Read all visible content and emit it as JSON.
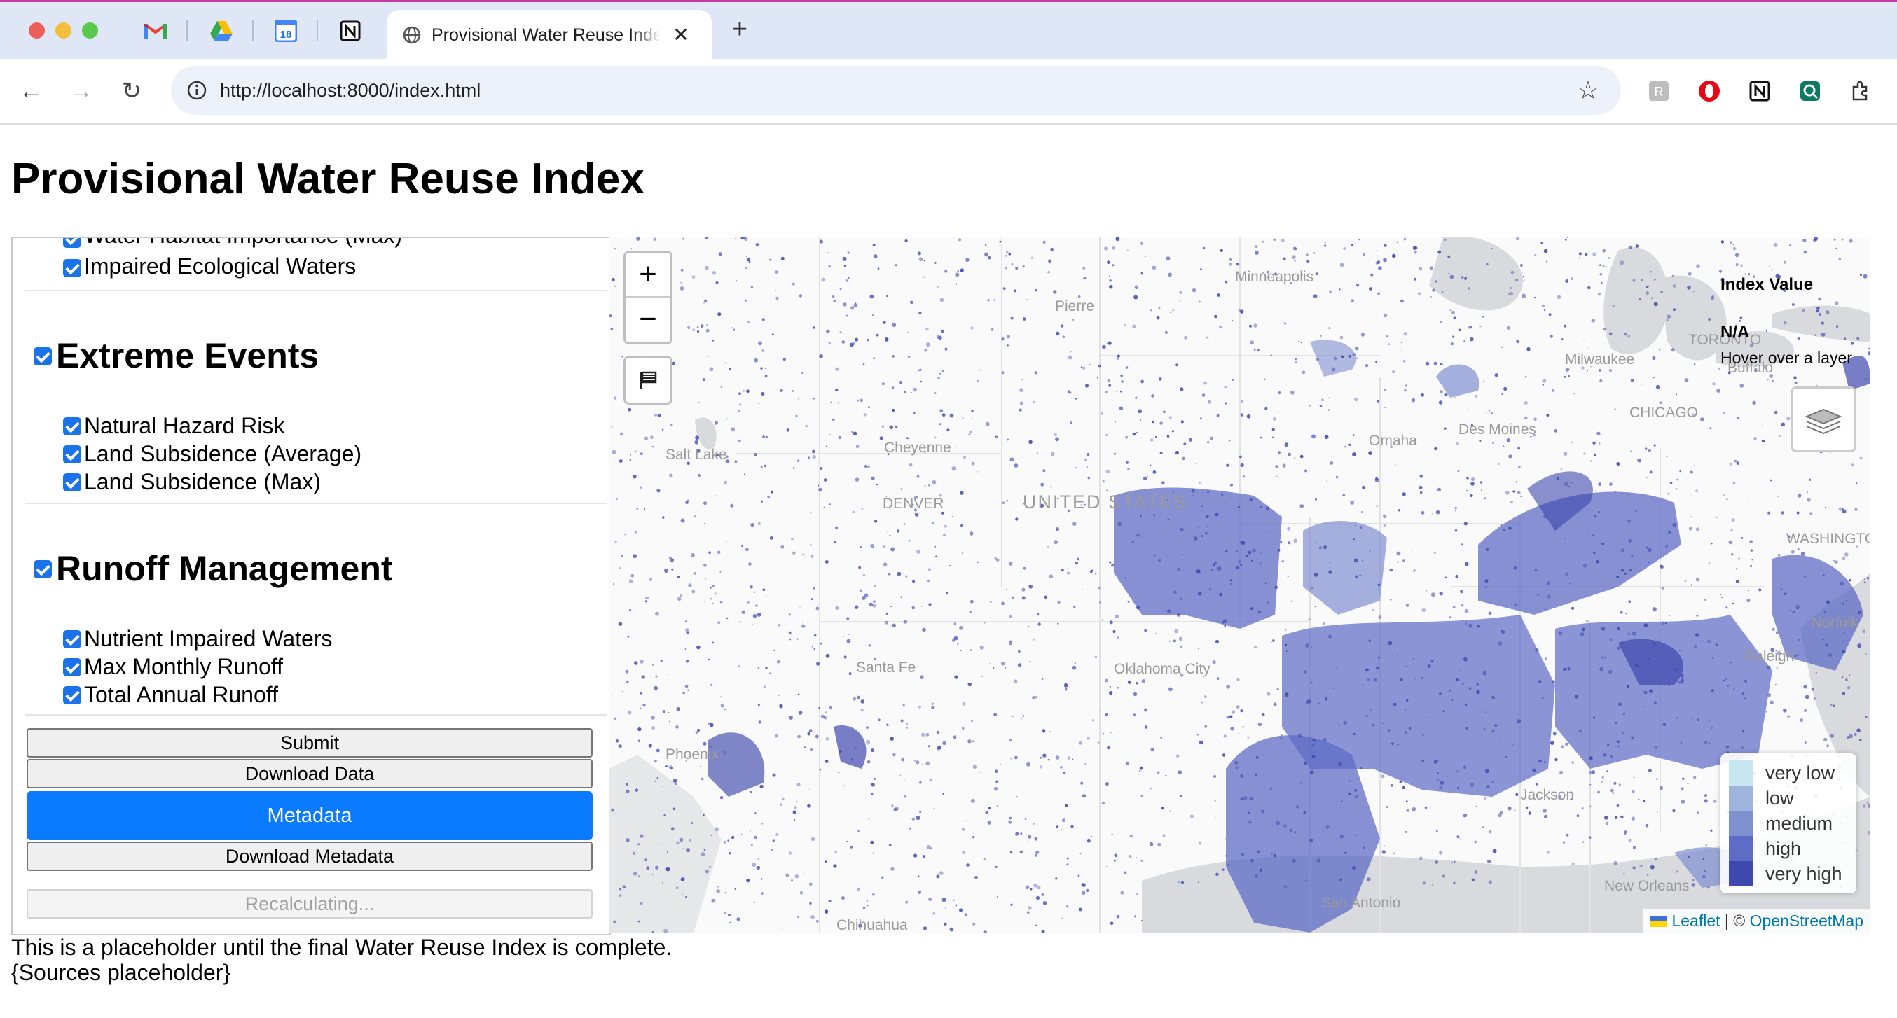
{
  "browser": {
    "active_tab_title": "Provisional Water Reuse Index",
    "tab_close_glyph": "✕",
    "new_tab_glyph": "+",
    "url": "http://localhost:8000/index.html",
    "pinned_tabs": [
      "gmail-icon",
      "google-drive-icon",
      "google-calendar-icon",
      "notion-icon"
    ],
    "calendar_day": "18",
    "extensions": [
      "extension-gray-icon",
      "opera-icon",
      "notion-web-clipper-icon",
      "extension-green-icon",
      "puzzle-extensions-icon"
    ]
  },
  "page": {
    "title": "Provisional Water Reuse Index",
    "footer_line1": "This is a placeholder until the final Water Reuse Index is complete.",
    "footer_line2": "{Sources placeholder}"
  },
  "panel": {
    "items_top": [
      "Water Habitat Importance (Max)",
      "Impaired Ecological Waters"
    ],
    "section_extreme": "Extreme Events",
    "items_extreme": [
      "Natural Hazard Risk",
      "Land Subsidence (Average)",
      "Land Subsidence (Max)"
    ],
    "section_runoff": "Runoff Management",
    "items_runoff": [
      "Nutrient Impaired Waters",
      "Max Monthly Runoff",
      "Total Annual Runoff"
    ],
    "buttons": {
      "submit": "Submit",
      "download_data": "Download Data",
      "metadata": "Metadata",
      "download_metadata": "Download Metadata",
      "recalculating": "Recalculating..."
    }
  },
  "map": {
    "zoom_in": "+",
    "zoom_out": "−",
    "info_title": "Index Value",
    "info_value": "N/A",
    "info_hint": "Hover over a layer",
    "legend": [
      {
        "label": "very low",
        "color": "#c8e6f0"
      },
      {
        "label": "low",
        "color": "#9fb4dc"
      },
      {
        "label": "medium",
        "color": "#7f8fd0"
      },
      {
        "label": "high",
        "color": "#5f6cc6"
      },
      {
        "label": "very high",
        "color": "#3e48ae"
      }
    ],
    "attribution": {
      "leaflet": "Leaflet",
      "separator": "| ©",
      "osm": "OpenStreetMap"
    },
    "place_labels": [
      "Minneapolis",
      "Pierre",
      "TORONTO",
      "Buffalo",
      "Milwaukee",
      "CHICAGO",
      "Des Moines",
      "Omaha",
      "Salt Lake",
      "Cheyenne",
      "DENVER",
      "UNITED STATES",
      "WASHINGTON",
      "Norfolk",
      "Oklahoma City",
      "Santa Fe",
      "Phoenix",
      "Raleigh",
      "Jackson",
      "New Orleans",
      "San Antonio",
      "Chihuahua"
    ],
    "accent_color": "#3e48ae"
  }
}
